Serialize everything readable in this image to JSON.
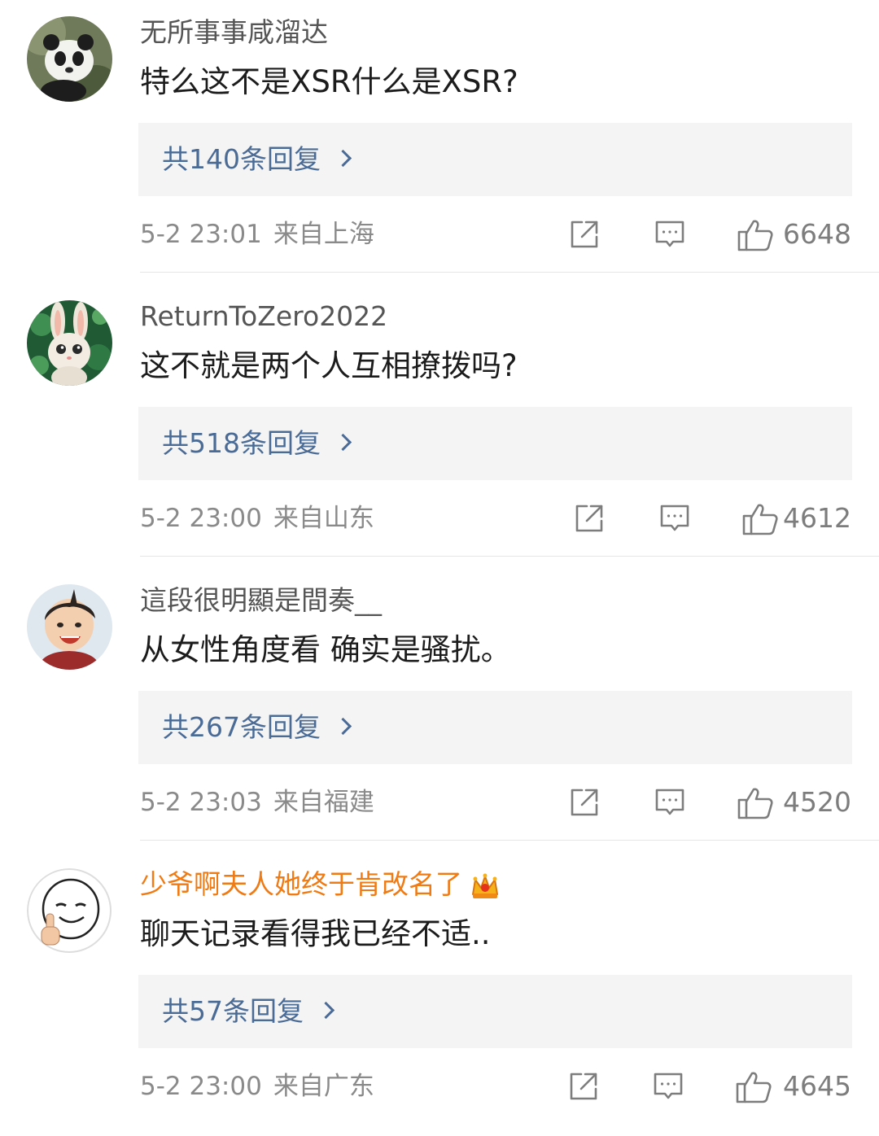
{
  "comments": [
    {
      "username": "无所事事咸溜达",
      "content": "特么这不是XSR什么是XSR?",
      "replies_label": "共140条回复",
      "time": "5-2 23:01",
      "location": "来自上海",
      "likes": "6648",
      "avatar_icon": "panda-avatar"
    },
    {
      "username": "ReturnToZero2022",
      "content": "这不就是两个人互相撩拨吗?",
      "replies_label": "共518条回复",
      "time": "5-2 23:00",
      "location": "来自山东",
      "likes": "4612",
      "avatar_icon": "rabbit-avatar"
    },
    {
      "username": "這段很明顯是間奏__",
      "content": "从女性角度看 确实是骚扰。",
      "replies_label": "共267条回复",
      "time": "5-2 23:03",
      "location": "来自福建",
      "likes": "4520",
      "avatar_icon": "child-avatar"
    },
    {
      "username": "少爷啊夫人她终于肯改名了",
      "content": "聊天记录看得我已经不适..",
      "replies_label": "共57条回复",
      "time": "5-2 23:00",
      "location": "来自广东",
      "likes": "4645",
      "avatar_icon": "sketch-face-avatar",
      "badge_icon": "crown-icon"
    }
  ],
  "colors": {
    "username": "#555555",
    "vip_username": "#f07a13",
    "reply_link": "#4a6b96",
    "reply_bg": "#f4f4f4",
    "meta": "#8a8a8a",
    "divider": "#e6e6e6"
  }
}
